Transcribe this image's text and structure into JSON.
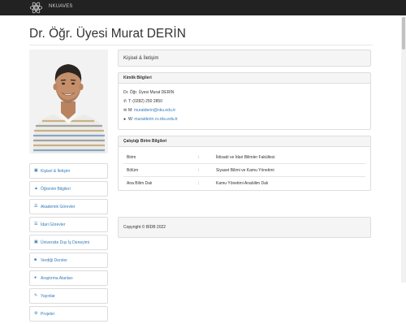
{
  "topbar": {
    "brand": "NKUAVES"
  },
  "page_title": "Dr. Öğr. Üyesi Murat DERİN",
  "menu": [
    {
      "label": "Kişisel & İletişim",
      "icon": "building-icon"
    },
    {
      "label": "Öğrenim Bilgileri",
      "icon": "graduation-cap-icon"
    },
    {
      "label": "Akademik Görevler",
      "icon": "list-icon"
    },
    {
      "label": "İdari Görevler",
      "icon": "list-icon"
    },
    {
      "label": "Üniversite Dışı İş Deneyimi",
      "icon": "building-icon"
    },
    {
      "label": "Verdiği Dersler",
      "icon": "book-icon"
    },
    {
      "label": "Araştırma Alanları",
      "icon": "users-icon"
    },
    {
      "label": "Yayınlar",
      "icon": "pencil-icon"
    },
    {
      "label": "Projeler",
      "icon": "gear-icon"
    }
  ],
  "main_panel": {
    "title": "Kişisel & İletişim"
  },
  "kimlik": {
    "heading": "Kimlik Bilgileri",
    "name": "Dr. Öğr. Üyesi Murat DERİN",
    "phone_label": "T:",
    "phone": "(0282) 250 2850",
    "email_label": "M:",
    "email": "muratderin@nku.edu.tr",
    "web_label": "W:",
    "web": "muratderin.cv.nku.edu.tr"
  },
  "birim": {
    "heading": "Çalıştığı Birim Bilgileri",
    "rows": [
      {
        "key": "Birim",
        "sep": ":",
        "value": "İktisadi ve İdari Bilimler Fakültesi"
      },
      {
        "key": "Bölüm",
        "sep": ":",
        "value": "Siyaset Bilimi ve Kamu Yönetimi"
      },
      {
        "key": "Ana Bilim Dalı",
        "sep": ":",
        "value": "Kamu Yönetimi Anabilim Dalı"
      }
    ]
  },
  "footer": {
    "copyright": "Copyright © BİDB 2022"
  },
  "colors": {
    "topbar": "#222222",
    "link": "#337ab7",
    "panel_bg": "#f5f5f5",
    "border": "#dddddd"
  }
}
